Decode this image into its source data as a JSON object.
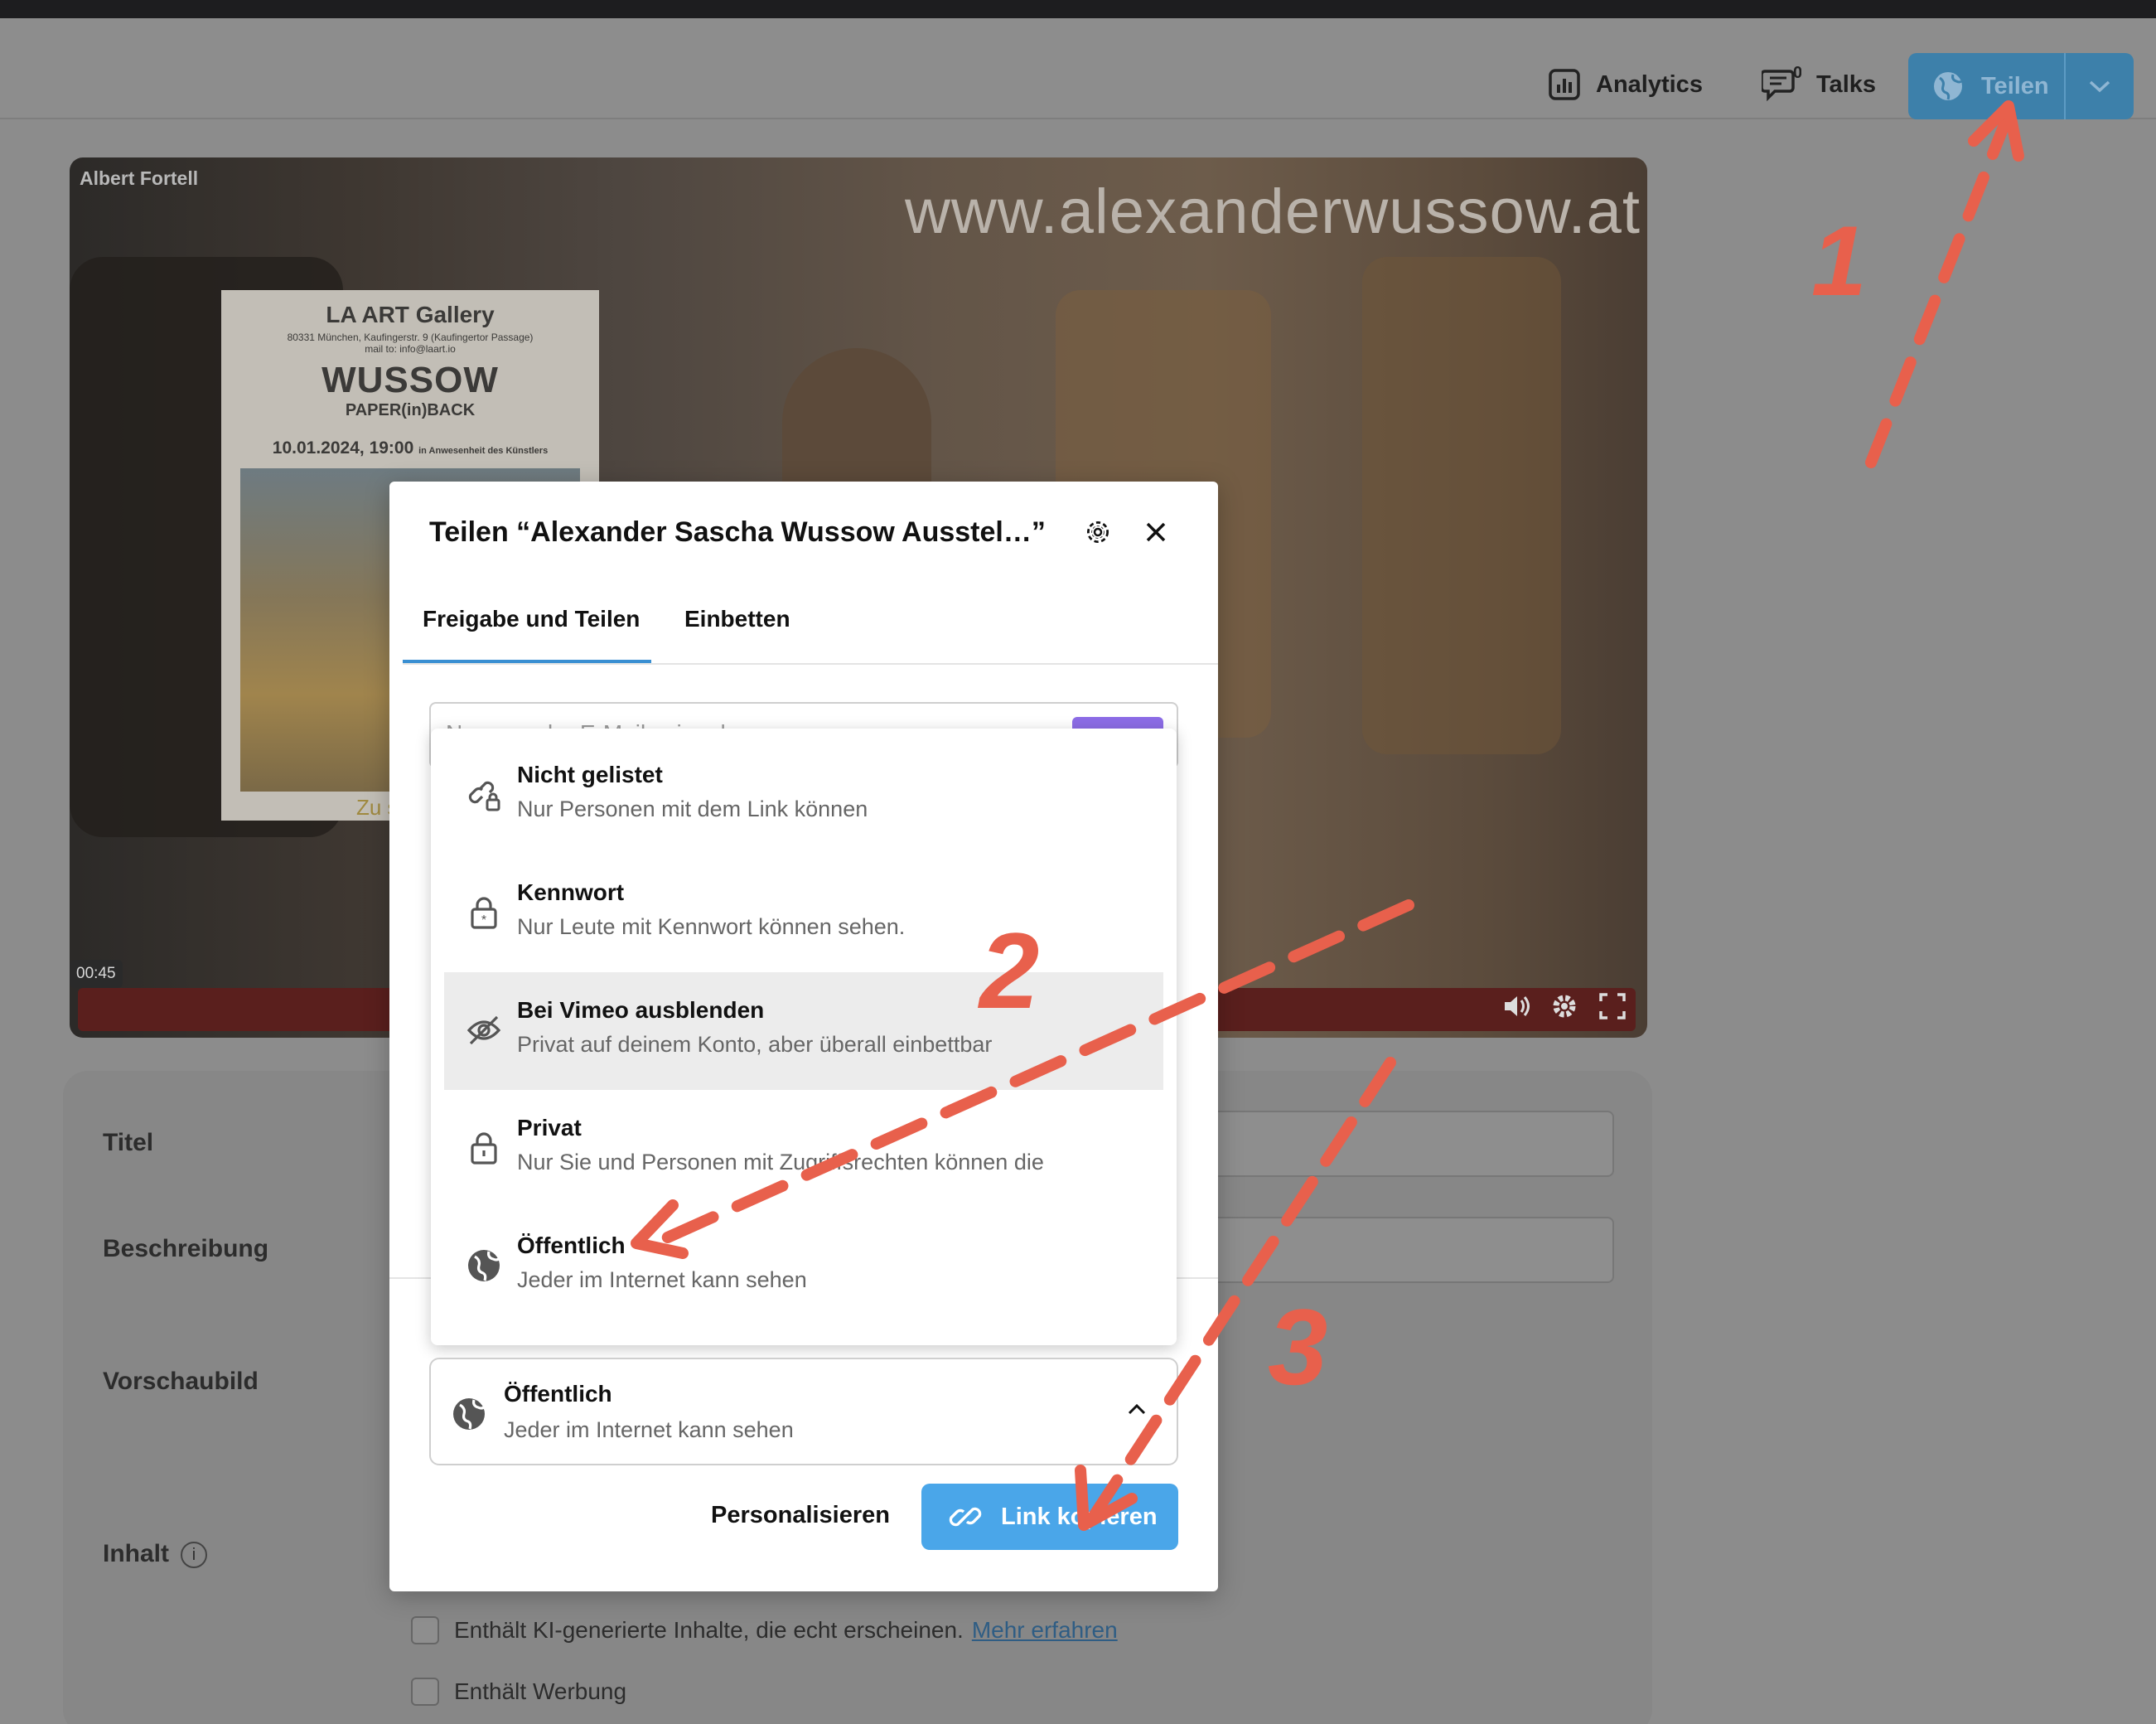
{
  "header": {
    "analytics_label": "Analytics",
    "talks_label": "Talks",
    "talks_badge": "0",
    "share_label": "Teilen"
  },
  "video": {
    "author": "Albert Fortell",
    "watermark": "www.alexanderwussow.at",
    "time": "00:45",
    "poster": {
      "gallery": "LA ART Gallery",
      "address": "80331 München, Kaufingerstr. 9 (Kaufingertor Passage)",
      "mail": "mail to: info@laart.io",
      "artist": "WUSSOW",
      "subtitle": "PAPER(in)BACK",
      "date": "10.01.2024, 19:00",
      "date_note": "in Anwesenheit des Künstlers",
      "footer": "Zu sehen b"
    }
  },
  "form": {
    "title_label": "Titel",
    "description_label": "Beschreibung",
    "thumbnail_label": "Vorschaubild",
    "content_label": "Inhalt",
    "checkbox_ai": "Enthält KI-generierte Inhalte, die echt erscheinen.",
    "checkbox_ai_link": "Mehr erfahren",
    "checkbox_ads": "Enthält Werbung"
  },
  "modal": {
    "title": "Teilen “Alexander Sascha Wussow Ausstel…”",
    "tabs": [
      "Freigabe und Teilen",
      "Einbetten"
    ],
    "email_placeholder": "Namen oder E-Mails eingeben",
    "options": [
      {
        "title": "Nicht gelistet",
        "desc": "Nur Personen mit dem Link können",
        "icon": "link-lock-icon"
      },
      {
        "title": "Kennwort",
        "desc": "Nur Leute mit Kennwort können sehen.",
        "icon": "password-lock-icon"
      },
      {
        "title": "Bei Vimeo ausblenden",
        "desc": "Privat auf deinem Konto, aber überall einbettbar",
        "icon": "eye-slash-icon"
      },
      {
        "title": "Privat",
        "desc": "Nur Sie und Personen mit Zugriffsrechten können die",
        "icon": "lock-icon"
      },
      {
        "title": "Öffentlich",
        "desc": "Jeder im Internet kann sehen",
        "icon": "globe-icon"
      }
    ],
    "selected": {
      "title": "Öffentlich",
      "desc": "Jeder im Internet kann sehen"
    },
    "customize_label": "Personalisieren",
    "copy_link_label": "Link kopieren"
  },
  "annotations": {
    "step1": "1",
    "step2": "2",
    "step3": "3",
    "color": "#e8604c"
  }
}
